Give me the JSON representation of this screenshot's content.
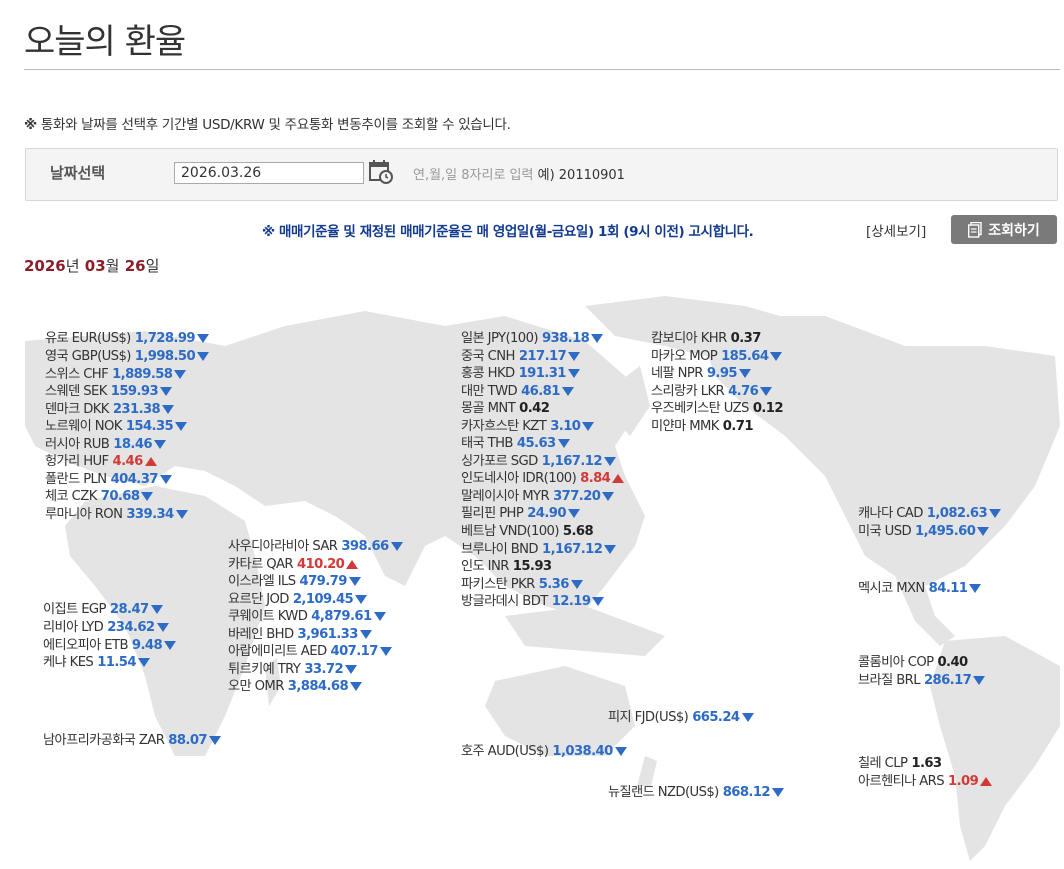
{
  "page": {
    "title": "오늘의 환율"
  },
  "notice": {
    "mark": "※",
    "text": "통화와 날짜를 선택후 기간별 USD/KRW 및 주요통화 변동추이를 조회할 수 있습니다."
  },
  "date_select": {
    "label": "날짜선택",
    "value": "2026.03.26",
    "hint": "연,월,일 8자리로 입력",
    "example": "예) 20110901"
  },
  "notice2": "※ 매매기준율 및 재정된 매매기준율은 매 영업일(월-금요일) 1회 (9시 이전) 고시합니다.",
  "detail_link": "[상세보기]",
  "query_button": "조회하기",
  "date_heading": {
    "year": "2026",
    "year_unit": "년",
    "month": "03",
    "month_unit": "월",
    "day": "26",
    "day_unit": "일"
  },
  "colors": {
    "down": "#2d6bc4",
    "up": "#d23a3a",
    "heading": "#8a1f2a",
    "notice2": "#123a8e"
  },
  "rates": [
    {
      "name": "유로 EUR(US$)",
      "value": "1,728.99",
      "dir": "down"
    },
    {
      "name": "영국 GBP(US$)",
      "value": "1,998.50",
      "dir": "down"
    },
    {
      "name": "스위스 CHF",
      "value": "1,889.58",
      "dir": "down"
    },
    {
      "name": "스웨덴 SEK",
      "value": "159.93",
      "dir": "down"
    },
    {
      "name": "덴마크 DKK",
      "value": "231.38",
      "dir": "down"
    },
    {
      "name": "노르웨이 NOK",
      "value": "154.35",
      "dir": "down"
    },
    {
      "name": "러시아 RUB",
      "value": "18.46",
      "dir": "down"
    },
    {
      "name": "헝가리 HUF",
      "value": "4.46",
      "dir": "up"
    },
    {
      "name": "폴란드 PLN",
      "value": "404.37",
      "dir": "down"
    },
    {
      "name": "체코 CZK",
      "value": "70.68",
      "dir": "down"
    },
    {
      "name": "루마니아 RON",
      "value": "339.34",
      "dir": "down"
    },
    {
      "name": "이집트 EGP",
      "value": "28.47",
      "dir": "down"
    },
    {
      "name": "리비아 LYD",
      "value": "234.62",
      "dir": "down"
    },
    {
      "name": "에티오피아 ETB",
      "value": "9.48",
      "dir": "down"
    },
    {
      "name": "케냐 KES",
      "value": "11.54",
      "dir": "down"
    },
    {
      "name": "남아프리카공화국 ZAR",
      "value": "88.07",
      "dir": "down"
    },
    {
      "name": "사우디아라비아 SAR",
      "value": "398.66",
      "dir": "down"
    },
    {
      "name": "카타르 QAR",
      "value": "410.20",
      "dir": "up"
    },
    {
      "name": "이스라엘 ILS",
      "value": "479.79",
      "dir": "down"
    },
    {
      "name": "요르단 JOD",
      "value": "2,109.45",
      "dir": "down"
    },
    {
      "name": "쿠웨이트 KWD",
      "value": "4,879.61",
      "dir": "down"
    },
    {
      "name": "바레인 BHD",
      "value": "3,961.33",
      "dir": "down"
    },
    {
      "name": "아랍에미리트 AED",
      "value": "407.17",
      "dir": "down"
    },
    {
      "name": "튀르키예 TRY",
      "value": "33.72",
      "dir": "down"
    },
    {
      "name": "오만 OMR",
      "value": "3,884.68",
      "dir": "down"
    },
    {
      "name": "일본 JPY(100)",
      "value": "938.18",
      "dir": "down"
    },
    {
      "name": "중국 CNH",
      "value": "217.17",
      "dir": "down"
    },
    {
      "name": "홍콩 HKD",
      "value": "191.31",
      "dir": "down"
    },
    {
      "name": "대만 TWD",
      "value": "46.81",
      "dir": "down"
    },
    {
      "name": "몽골 MNT",
      "value": "0.42",
      "dir": "same"
    },
    {
      "name": "카자흐스탄 KZT",
      "value": "3.10",
      "dir": "down"
    },
    {
      "name": "태국 THB",
      "value": "45.63",
      "dir": "down"
    },
    {
      "name": "싱가포르 SGD",
      "value": "1,167.12",
      "dir": "down"
    },
    {
      "name": "인도네시아 IDR(100)",
      "value": "8.84",
      "dir": "up"
    },
    {
      "name": "말레이시아 MYR",
      "value": "377.20",
      "dir": "down"
    },
    {
      "name": "필리핀 PHP",
      "value": "24.90",
      "dir": "down"
    },
    {
      "name": "베트남 VND(100)",
      "value": "5.68",
      "dir": "same"
    },
    {
      "name": "브루나이 BND",
      "value": "1,167.12",
      "dir": "down"
    },
    {
      "name": "인도 INR",
      "value": "15.93",
      "dir": "same"
    },
    {
      "name": "파키스탄 PKR",
      "value": "5.36",
      "dir": "down"
    },
    {
      "name": "방글라데시 BDT",
      "value": "12.19",
      "dir": "down"
    },
    {
      "name": "캄보디아 KHR",
      "value": "0.37",
      "dir": "same"
    },
    {
      "name": "마카오 MOP",
      "value": "185.64",
      "dir": "down"
    },
    {
      "name": "네팔 NPR",
      "value": "9.95",
      "dir": "down"
    },
    {
      "name": "스리랑카 LKR",
      "value": "4.76",
      "dir": "down"
    },
    {
      "name": "우즈베키스탄 UZS",
      "value": "0.12",
      "dir": "same"
    },
    {
      "name": "미얀마 MMK",
      "value": "0.71",
      "dir": "same"
    },
    {
      "name": "피지 FJD(US$)",
      "value": "665.24",
      "dir": "down"
    },
    {
      "name": "호주 AUD(US$)",
      "value": "1,038.40",
      "dir": "down"
    },
    {
      "name": "뉴질랜드 NZD(US$)",
      "value": "868.12",
      "dir": "down"
    },
    {
      "name": "캐나다 CAD",
      "value": "1,082.63",
      "dir": "down"
    },
    {
      "name": "미국 USD",
      "value": "1,495.60",
      "dir": "down"
    },
    {
      "name": "멕시코 MXN",
      "value": "84.11",
      "dir": "down"
    },
    {
      "name": "콜롬비아 COP",
      "value": "0.40",
      "dir": "same"
    },
    {
      "name": "브라질 BRL",
      "value": "286.17",
      "dir": "down"
    },
    {
      "name": "칠레 CLP",
      "value": "1.63",
      "dir": "same"
    },
    {
      "name": "아르헨티나 ARS",
      "value": "1.09",
      "dir": "up"
    }
  ]
}
